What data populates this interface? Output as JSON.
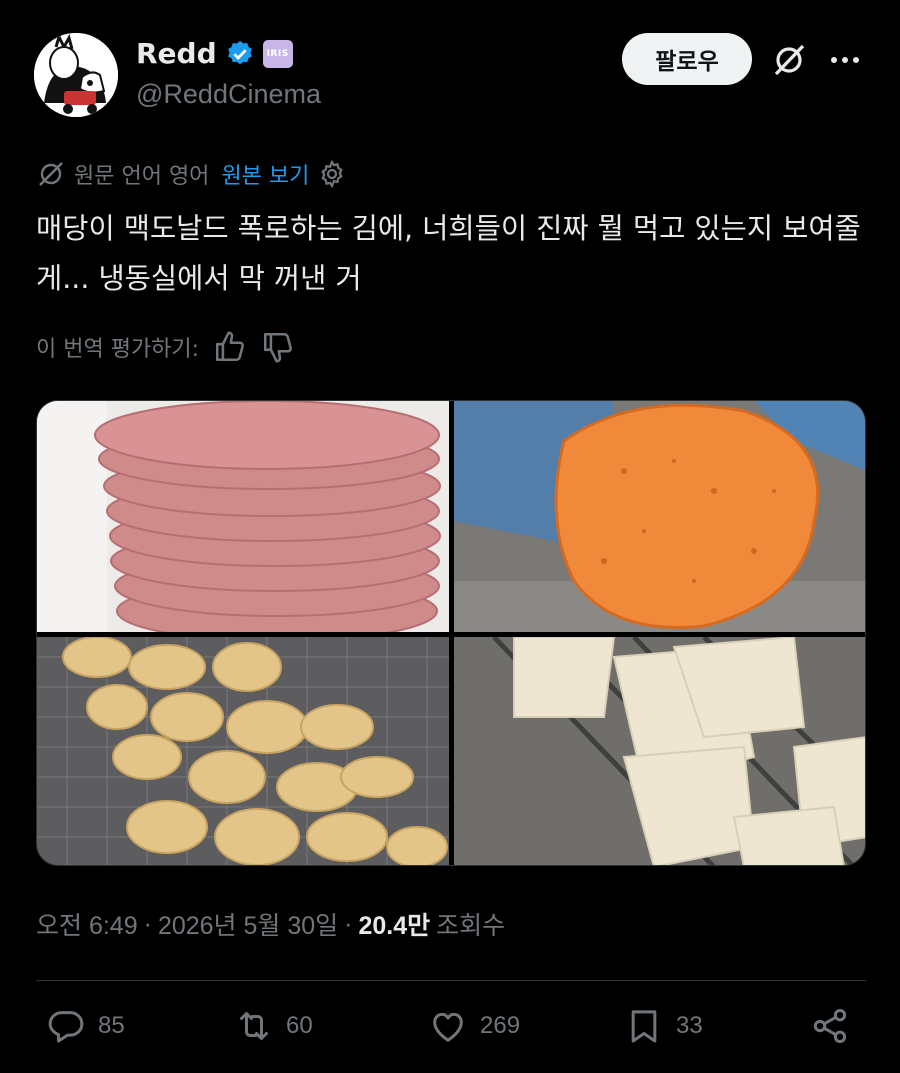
{
  "author": {
    "display_name": "Redd",
    "handle": "@ReddCinema",
    "affiliate_badge": "IRIS"
  },
  "header": {
    "follow_label": "팔로우"
  },
  "translation": {
    "meta": "원문 언어 영어",
    "show_original": "원본 보기"
  },
  "tweet": {
    "text": "매당이 맥도날드 폭로하는 김에, 너희들이 진짜 뭘 먹고 있는지 보여줄게... 냉동실에서 막 꺼낸 거"
  },
  "rate": {
    "label": "이 번역 평가하기:"
  },
  "meta": {
    "time": "오전 6:49",
    "date": "2026년 5월 30일",
    "views": "20.4만",
    "views_label": "조회수"
  },
  "actions": {
    "replies": "85",
    "reposts": "60",
    "likes": "269",
    "bookmarks": "33"
  },
  "icons": {
    "verified": "verified-icon",
    "grok": "grok-icon",
    "more": "more-icon",
    "settings": "gear-icon",
    "thumbs_up": "thumbs-up-icon",
    "thumbs_down": "thumbs-down-icon",
    "reply": "reply-icon",
    "repost": "repost-icon",
    "like": "heart-icon",
    "bookmark": "bookmark-icon",
    "share": "share-icon"
  },
  "colors": {
    "background": "#000000",
    "text": "#e7e9ea",
    "muted": "#71767b",
    "accent": "#1d9bf0",
    "divider": "#2f3336"
  }
}
